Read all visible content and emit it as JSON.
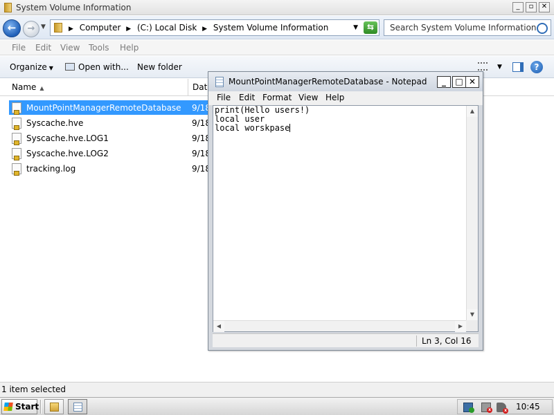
{
  "explorer": {
    "title": "System Volume Information",
    "window_controls": {
      "minimize": "_",
      "maximize": "▫",
      "close": "✕"
    },
    "nav": {
      "back": "←",
      "forward": "→",
      "history": "▼"
    },
    "breadcrumbs": [
      "Computer",
      "(C:) Local Disk",
      "System Volume Information"
    ],
    "breadcrumb_arrow": "▶",
    "address_dropdown": "▼",
    "refresh_glyph": "⇆",
    "search_placeholder": "Search System Volume Information",
    "menu": [
      "File",
      "Edit",
      "View",
      "Tools",
      "Help"
    ],
    "toolbar": {
      "organize": "Organize",
      "open_with": "Open with...",
      "new_folder": "New folder",
      "dropdown_arrow": "▼",
      "help": "?"
    },
    "columns": {
      "name": "Name",
      "sort_glyph": "▲",
      "date": "Date"
    },
    "files": [
      {
        "name": "MountPointManagerRemoteDatabase",
        "date": "9/18",
        "selected": true
      },
      {
        "name": "Syscache.hve",
        "date": "9/18",
        "selected": false
      },
      {
        "name": "Syscache.hve.LOG1",
        "date": "9/18",
        "selected": false
      },
      {
        "name": "Syscache.hve.LOG2",
        "date": "9/18",
        "selected": false
      },
      {
        "name": "tracking.log",
        "date": "9/18",
        "selected": false
      }
    ],
    "status": "1 item selected"
  },
  "notepad": {
    "title": "MountPointManagerRemoteDatabase - Notepad",
    "controls": {
      "minimize": "_",
      "maximize": "□",
      "close": "✕"
    },
    "menu": [
      "File",
      "Edit",
      "Format",
      "View",
      "Help"
    ],
    "lines": [
      "print(Hello users!)",
      "local user",
      "local worskpase"
    ],
    "scroll": {
      "up": "▲",
      "down": "▼",
      "left": "◀",
      "right": "▶"
    },
    "status_position": "Ln 3, Col 16"
  },
  "taskbar": {
    "start_label": "Start",
    "clock": "10:45"
  },
  "colors": {
    "selection": "#3399ff",
    "accent_blue": "#1f5fb8",
    "title_text": "#333333"
  }
}
